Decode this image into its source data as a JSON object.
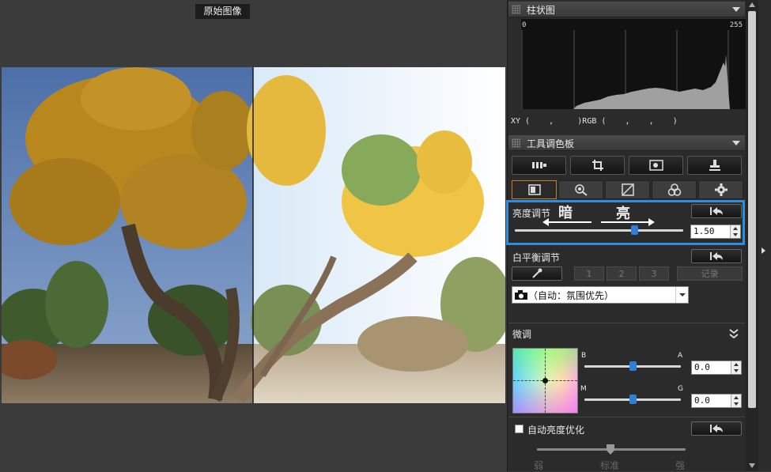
{
  "viewer": {
    "original_label": "原始图像"
  },
  "histogram": {
    "title": "柱状图",
    "tick_min": "0",
    "tick_max": "255",
    "readout": "XY (    ,     )RGB (    ,    ,    )"
  },
  "palette": {
    "title": "工具调色板",
    "tool_buttons": [
      "exposure-icon",
      "crop-icon",
      "dust-icon",
      "stamp-icon"
    ],
    "tabs": [
      "tone-icon",
      "zoom-icon",
      "curve-icon",
      "color-icon",
      "settings-icon"
    ]
  },
  "brightness": {
    "label": "亮度调节",
    "dark_annotation": "暗",
    "bright_annotation": "亮",
    "value": "1.50",
    "level": 0.71
  },
  "white_balance": {
    "label": "白平衡调节",
    "buttons": [
      "1",
      "2",
      "3"
    ],
    "record_label": "记录",
    "mode": "（自动：氛围优先）"
  },
  "fine_tune": {
    "label": "微调",
    "axis_b": "B",
    "axis_a": "A",
    "axis_m": "M",
    "axis_g": "G",
    "ba_value": "0.0",
    "mg_value": "0.0"
  },
  "auto_lighting": {
    "label": "自动亮度优化",
    "checked": false,
    "weak": "弱",
    "standard": "标准",
    "strong": "强"
  },
  "colors": {
    "highlight": "#2f8de0",
    "active_tab": "#c08020",
    "thumb": "#2f7fd6"
  }
}
